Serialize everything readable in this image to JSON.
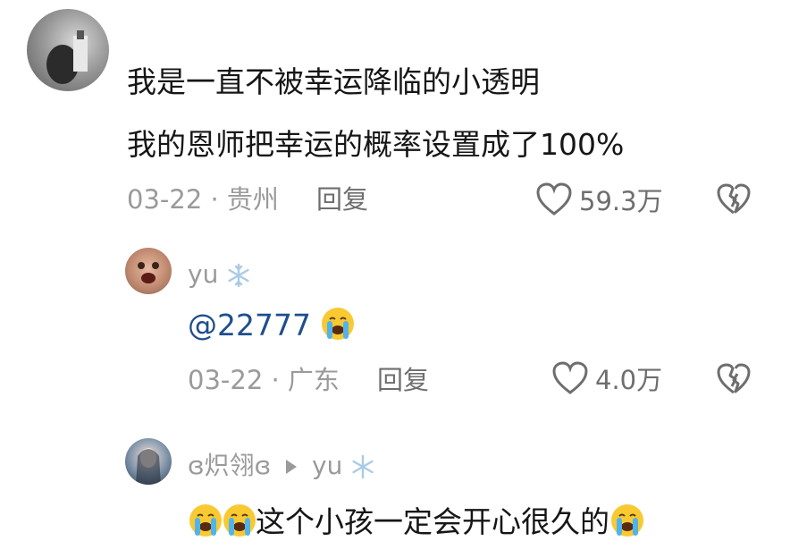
{
  "comments": [
    {
      "avatar_icon": "avatar-photo-icon",
      "lines": [
        "我是一直不被幸运降临的小透明",
        "我的恩师把幸运的概率设置成了100%"
      ],
      "meta": "03-22 · 贵州",
      "reply_label": "回复",
      "likes": "59.3万"
    },
    {
      "username": "yu",
      "username_icon": "snowflake-icon",
      "mention": "@22777",
      "text_emoji": "crying-face-emoji",
      "meta": "03-22 · 广东",
      "reply_label": "回复",
      "likes": "4.0万"
    },
    {
      "username": "ɞ炽翎ɞ",
      "reply_to": "yu",
      "reply_arrow_icon": "triangle-right-icon",
      "text": "这个小孩一定会开心很久的"
    }
  ],
  "colors": {
    "text": "#161616",
    "meta": "#9a9a9a",
    "mention": "#1f4e8c"
  }
}
